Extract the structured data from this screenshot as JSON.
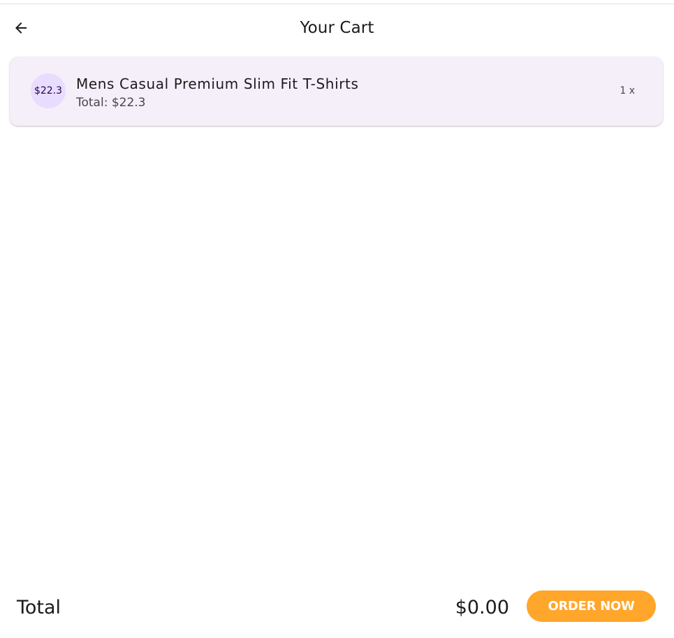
{
  "header": {
    "title": "Your Cart",
    "back_icon": "arrow-left-icon"
  },
  "cart": {
    "items": [
      {
        "avatar_price": "$22.3",
        "title": "Mens Casual Premium Slim Fit T-Shirts",
        "total_text": "Total: $22.3",
        "quantity_text": "1 x"
      }
    ]
  },
  "footer": {
    "total_label": "Total",
    "total_value": "$0.00",
    "order_button_label": "ORDER NOW"
  },
  "colors": {
    "card_background": "#f4eff8",
    "avatar_background": "#e9ddff",
    "order_button": "#ffa62b"
  }
}
